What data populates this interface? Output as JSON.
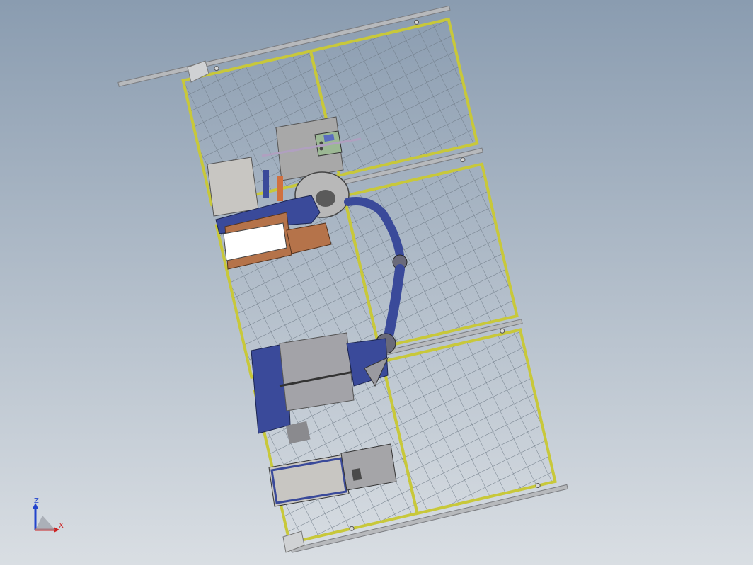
{
  "viewport": {
    "background_top": "#8a9cb0",
    "background_bottom": "#d9dee3"
  },
  "colors": {
    "fence_frame": "#c8c83a",
    "fence_mesh": "#6e7a86",
    "rail": "#b7b9bc",
    "robot_blue": "#3a4a9a",
    "table_brown": "#b5734a",
    "cabinet_grey": "#a6a6a6",
    "panel_green": "#8fae88"
  },
  "triad": {
    "z_label": "Z",
    "x_label": "X",
    "z_color": "#2244cc",
    "x_color": "#cc2222"
  }
}
